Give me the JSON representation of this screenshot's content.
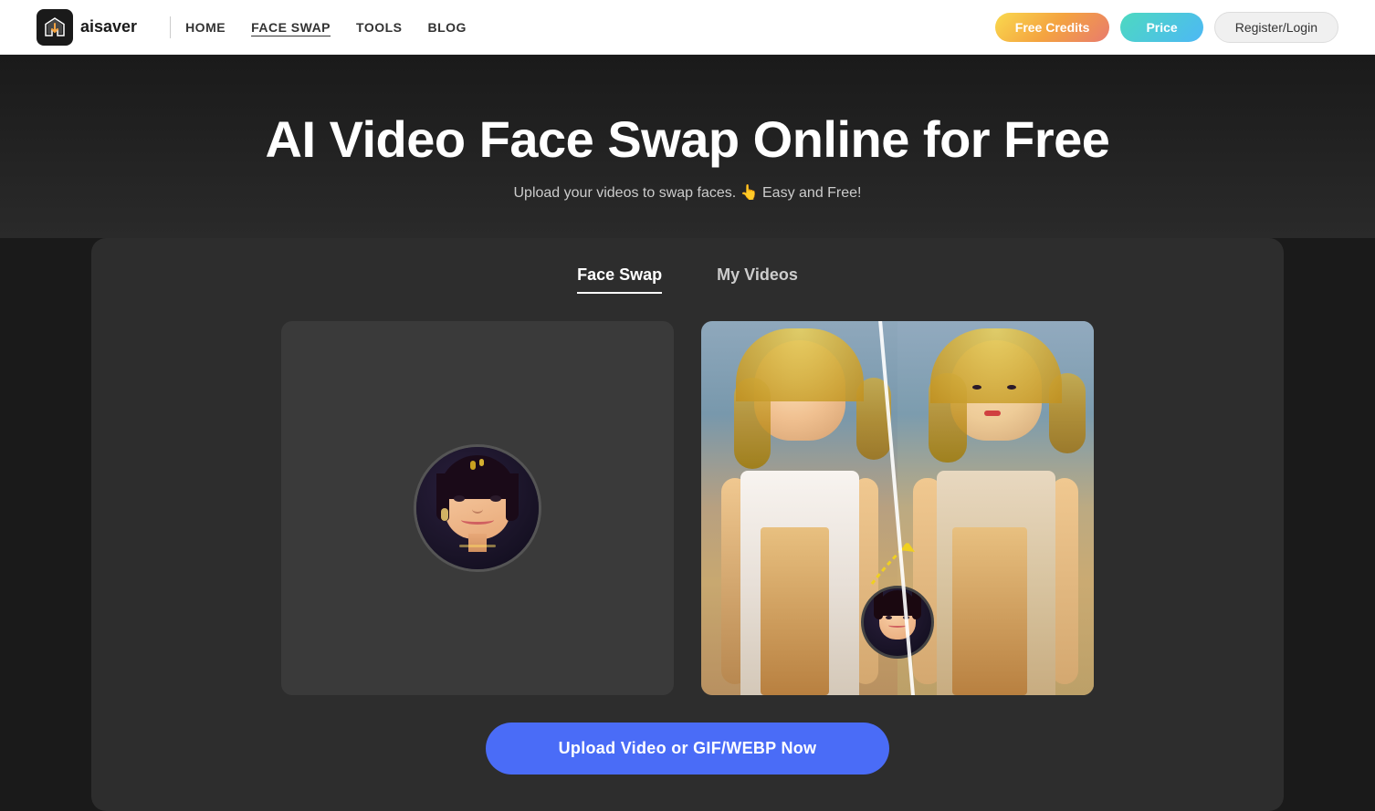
{
  "app": {
    "logo_text": "aisaver"
  },
  "navbar": {
    "home": "HOME",
    "face_swap": "FACE SWAP",
    "tools": "TOOLS",
    "blog": "BLOG",
    "free_credits": "Free Credits",
    "price": "Price",
    "register_login": "Register/Login"
  },
  "hero": {
    "title": "AI Video Face Swap Online for Free",
    "subtitle": "Upload your videos to swap faces. 👆 Easy and Free!"
  },
  "tabs": {
    "face_swap": "Face Swap",
    "my_videos": "My Videos"
  },
  "upload": {
    "button_label": "Upload Video or GIF/WEBP Now"
  }
}
